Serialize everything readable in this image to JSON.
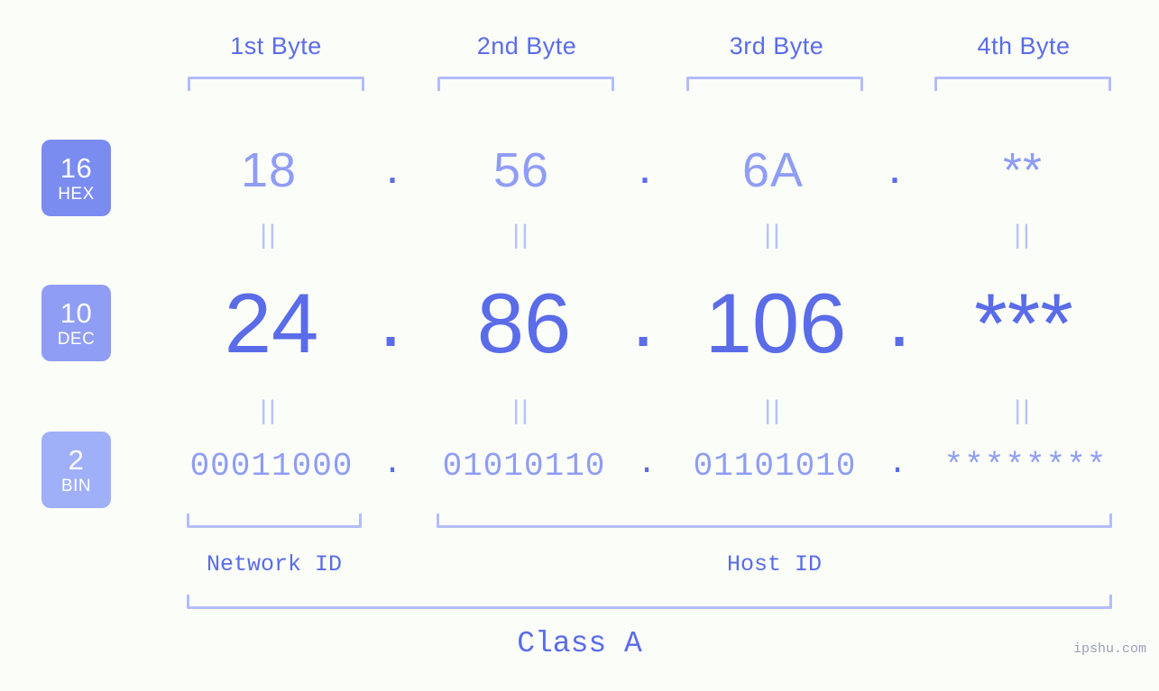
{
  "page": {
    "background": "#fbfdf9",
    "accent_strong": "#5a6ce8",
    "accent_mid": "#8f9df4",
    "accent_light": "#b3bdfb",
    "watermark": "ipshu.com"
  },
  "byte_headers": [
    {
      "label": "1st Byte"
    },
    {
      "label": "2nd Byte"
    },
    {
      "label": "3rd Byte"
    },
    {
      "label": "4th Byte"
    }
  ],
  "bases": [
    {
      "number": "16",
      "name": "HEX",
      "color": "#7b8cf0"
    },
    {
      "number": "10",
      "name": "DEC",
      "color": "#8f9df4"
    },
    {
      "number": "2",
      "name": "BIN",
      "color": "#9fb0f8"
    }
  ],
  "rows": {
    "hex": {
      "values": [
        "18",
        "56",
        "6A",
        "**"
      ],
      "separator": "."
    },
    "dec": {
      "values": [
        "24",
        "86",
        "106",
        "***"
      ],
      "separator": "."
    },
    "bin": {
      "values": [
        "00011000",
        "01010110",
        "01101010",
        "********"
      ],
      "separator": "."
    }
  },
  "equals_marks": {
    "symbol": "||",
    "count_per_row": 4
  },
  "sections": {
    "network_id": "Network ID",
    "host_id": "Host ID",
    "class": "Class A"
  }
}
